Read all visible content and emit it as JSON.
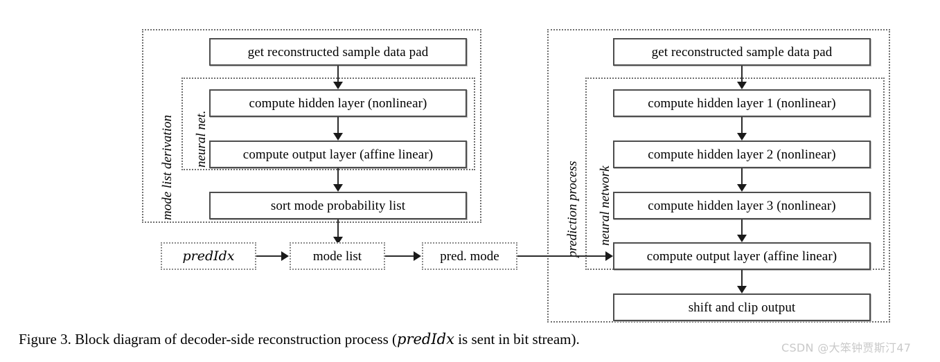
{
  "figure": {
    "caption_before": "Figure 3. Block diagram of decoder-side reconstruction process (",
    "caption_term": "predIdx",
    "caption_after": " is sent in bit stream).",
    "watermark": "CSDN @大笨钟贾斯汀47"
  },
  "left_panel": {
    "label": "mode list derivation",
    "inner_label": "neural net.",
    "boxes": [
      {
        "label": "get reconstructed  sample data pad"
      },
      {
        "label": "compute hidden  layer (nonlinear)"
      },
      {
        "label": "compute output layer (affine  linear)"
      },
      {
        "label": "sort mode probability  list"
      }
    ]
  },
  "right_panel": {
    "label": "prediction process",
    "inner_label": "neural network",
    "boxes": [
      {
        "label": "get reconstructed  sample data pad"
      },
      {
        "label": "compute hidden layer 1 (nonlinear)"
      },
      {
        "label": "compute hidden layer 2 (nonlinear)"
      },
      {
        "label": "compute hidden layer 3 (nonlinear)"
      },
      {
        "label": "compute output layer (affine  linear)"
      },
      {
        "label": "shift and clip output"
      }
    ]
  },
  "middle_row": {
    "boxes": [
      {
        "label": "predIdx",
        "italic": true
      },
      {
        "label": "mode list",
        "italic": false
      },
      {
        "label": "pred. mode",
        "italic": false
      }
    ]
  },
  "colors": {
    "box_border": "#4d4d4d",
    "group_border": "#6e6e6e",
    "connector": "#2b2b2b",
    "watermark": "#c9c9c9"
  }
}
